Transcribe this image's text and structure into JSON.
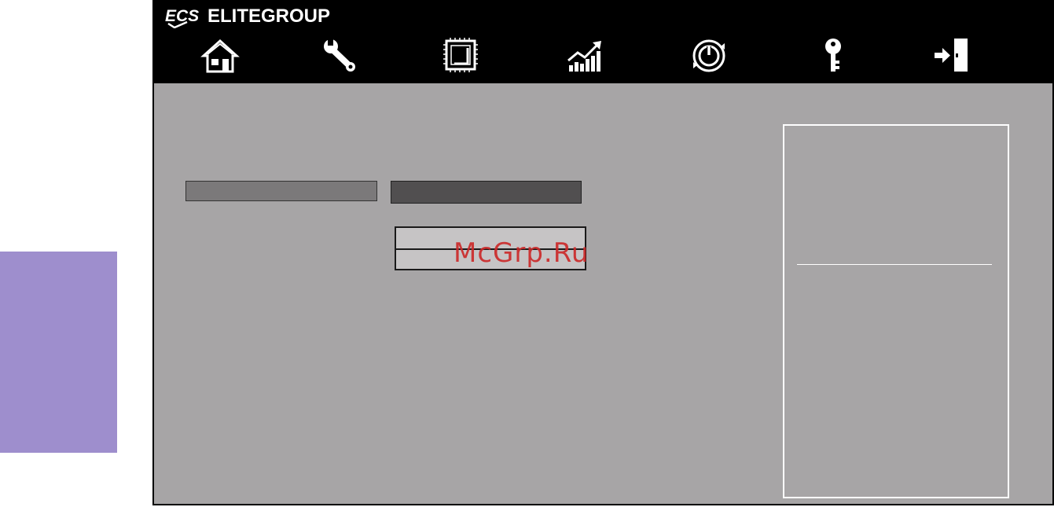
{
  "app": {
    "brand_name": "ELITEGROUP",
    "brand_logo_text": "ECS"
  },
  "nav": {
    "items": [
      {
        "id": "main",
        "icon": "home-icon"
      },
      {
        "id": "advanced",
        "icon": "wrench-icon"
      },
      {
        "id": "chipset",
        "icon": "chip-icon"
      },
      {
        "id": "mib",
        "icon": "performance-chart-icon"
      },
      {
        "id": "boot",
        "icon": "power-icon"
      },
      {
        "id": "security",
        "icon": "key-icon"
      },
      {
        "id": "exit",
        "icon": "exit-door-icon"
      }
    ]
  },
  "watermark": {
    "text": "McGrp.Ru"
  },
  "colors": {
    "panel": "#a7a5a6",
    "side_tab": "#9e8ecd",
    "topbar": "#000000",
    "watermark": "#cc2a2a"
  }
}
